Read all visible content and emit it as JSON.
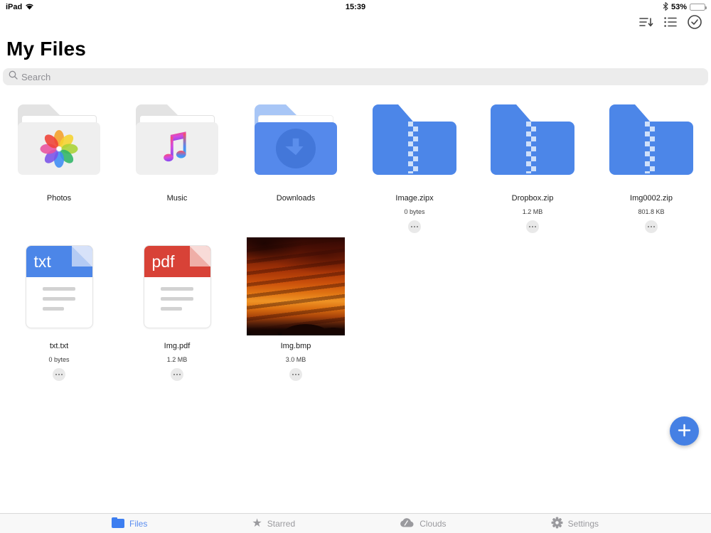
{
  "status_bar": {
    "carrier": "iPad",
    "time": "15:39",
    "battery_percent": "53%",
    "icons": [
      "wifi-icon",
      "bluetooth-icon",
      "battery-icon"
    ]
  },
  "toolbar": {
    "icons": [
      "sort-descending-icon",
      "list-view-icon",
      "select-circle-check-icon"
    ]
  },
  "header": {
    "title": "My Files"
  },
  "search": {
    "placeholder": "Search",
    "icon": "search-icon"
  },
  "grid": {
    "items": [
      {
        "name": "Photos",
        "type": "folder-photos"
      },
      {
        "name": "Music",
        "type": "folder-music"
      },
      {
        "name": "Downloads",
        "type": "folder-downloads"
      },
      {
        "name": "Image.zipx",
        "size": "0 bytes",
        "type": "zip-folder"
      },
      {
        "name": "Dropbox.zip",
        "size": "1.2 MB",
        "type": "zip-folder"
      },
      {
        "name": "Img0002.zip",
        "size": "801.8 KB",
        "type": "zip-folder"
      },
      {
        "name": "txt.txt",
        "size": "0 bytes",
        "type": "document",
        "badge": "txt"
      },
      {
        "name": "Img.pdf",
        "size": "1.2 MB",
        "type": "document",
        "badge": "pdf"
      },
      {
        "name": "Img.bmp",
        "size": "3.0 MB",
        "type": "image-thumbnail"
      }
    ]
  },
  "fab": {
    "icon": "plus-icon"
  },
  "tab_bar": {
    "tabs": [
      {
        "label": "Files",
        "icon": "folder-icon",
        "active": true
      },
      {
        "label": "Starred",
        "icon": "star-icon",
        "active": false
      },
      {
        "label": "Clouds",
        "icon": "cloud-icon",
        "active": false
      },
      {
        "label": "Settings",
        "icon": "gear-icon",
        "active": false
      }
    ]
  },
  "colors": {
    "accent_blue": "#4C86E8",
    "downloads_circle": "#4377D9",
    "pdf_red": "#D84237",
    "inactive_gray": "#9A9A9E",
    "tab_active_blue": "#5A8DF0"
  }
}
